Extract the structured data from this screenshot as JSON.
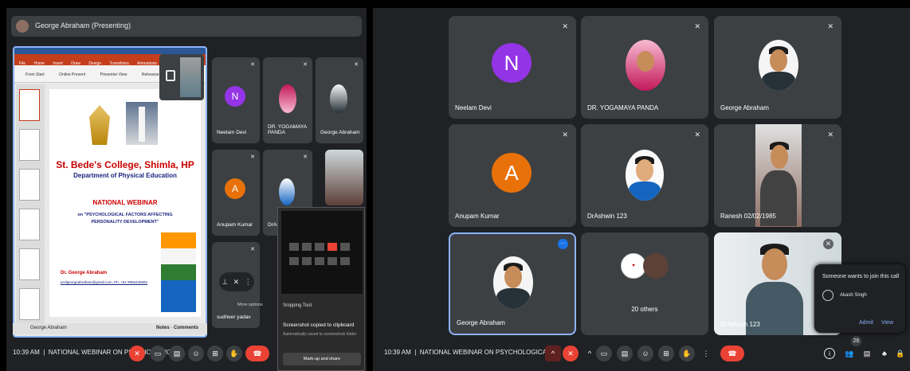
{
  "left": {
    "presenter_label": "George Abraham (Presenting)",
    "slide": {
      "college": "St. Bede's College, Shimla, HP",
      "department": "Department of Physical Education",
      "event": "NATIONAL WEBINAR",
      "topic": "on \"PSYCHOLOGICAL FACTORS AFFECTING PERSONALITY DEVELOPMENT\"",
      "speaker": "Dr. George Abraham",
      "contact": "profgeorgeabraham@gmail.com, Ph: +91 9906425582"
    },
    "ppt_tabs": [
      "File",
      "Home",
      "Insert",
      "Draw",
      "Design",
      "Transitions",
      "Animations"
    ],
    "ppt_tools": [
      "From Start",
      "Online Present",
      "Presenter View",
      "Rehearse with Coach"
    ],
    "footer": {
      "name": "George Abraham",
      "notes": "Notes",
      "comments": "Comments"
    },
    "tiles": [
      {
        "name": "Neelam Devi",
        "initial": "N"
      },
      {
        "name": "DR. YOGAMAYA PANDA"
      },
      {
        "name": "George Abraham"
      },
      {
        "name": "Anupam Kumar",
        "initial": "A"
      },
      {
        "name": "DrAshw"
      },
      {
        "name": "sudheer yadav"
      }
    ],
    "more_options": "More options",
    "snipping": {
      "app": "Snipping Tool",
      "title": "Screenshot copied to clipboard",
      "subtitle": "Automatically saved to screenshots folder",
      "action": "Mark-up and share"
    },
    "bottom": {
      "time": "10:39 AM",
      "meeting": "NATIONAL WEBINAR ON PSYCHOLOGICAL ..."
    }
  },
  "right": {
    "tiles": [
      {
        "name": "Neelam Devi",
        "initial": "N"
      },
      {
        "name": "DR. YOGAMAYA PANDA"
      },
      {
        "name": "George Abraham"
      },
      {
        "name": "Anupam Kumar",
        "initial": "A"
      },
      {
        "name": "DrAshwin 123"
      },
      {
        "name": "Ranesh 02/02/1985"
      },
      {
        "name": "George Abraham"
      },
      {
        "name": "20 others"
      },
      {
        "name": "DrAshwin 123"
      }
    ],
    "join": {
      "title": "Someone wants to join this call",
      "person": "Akash Singh",
      "admit": "Admit",
      "view": "View"
    },
    "bottom": {
      "time": "10:39 AM",
      "meeting": "NATIONAL WEBINAR ON PSYCHOLOGICAL ...",
      "participants": "26"
    }
  },
  "icons": {
    "mic_off": "✕",
    "chevron": "^",
    "more": "⋮",
    "end_call": "☎",
    "hand": "✋",
    "emoji": "☺",
    "info": "i"
  },
  "colors": {
    "accent": "#8ab4f8",
    "danger": "#ea4335",
    "tile": "#3c4043",
    "avatar_n": "#9334e6",
    "avatar_a": "#e8710a"
  }
}
